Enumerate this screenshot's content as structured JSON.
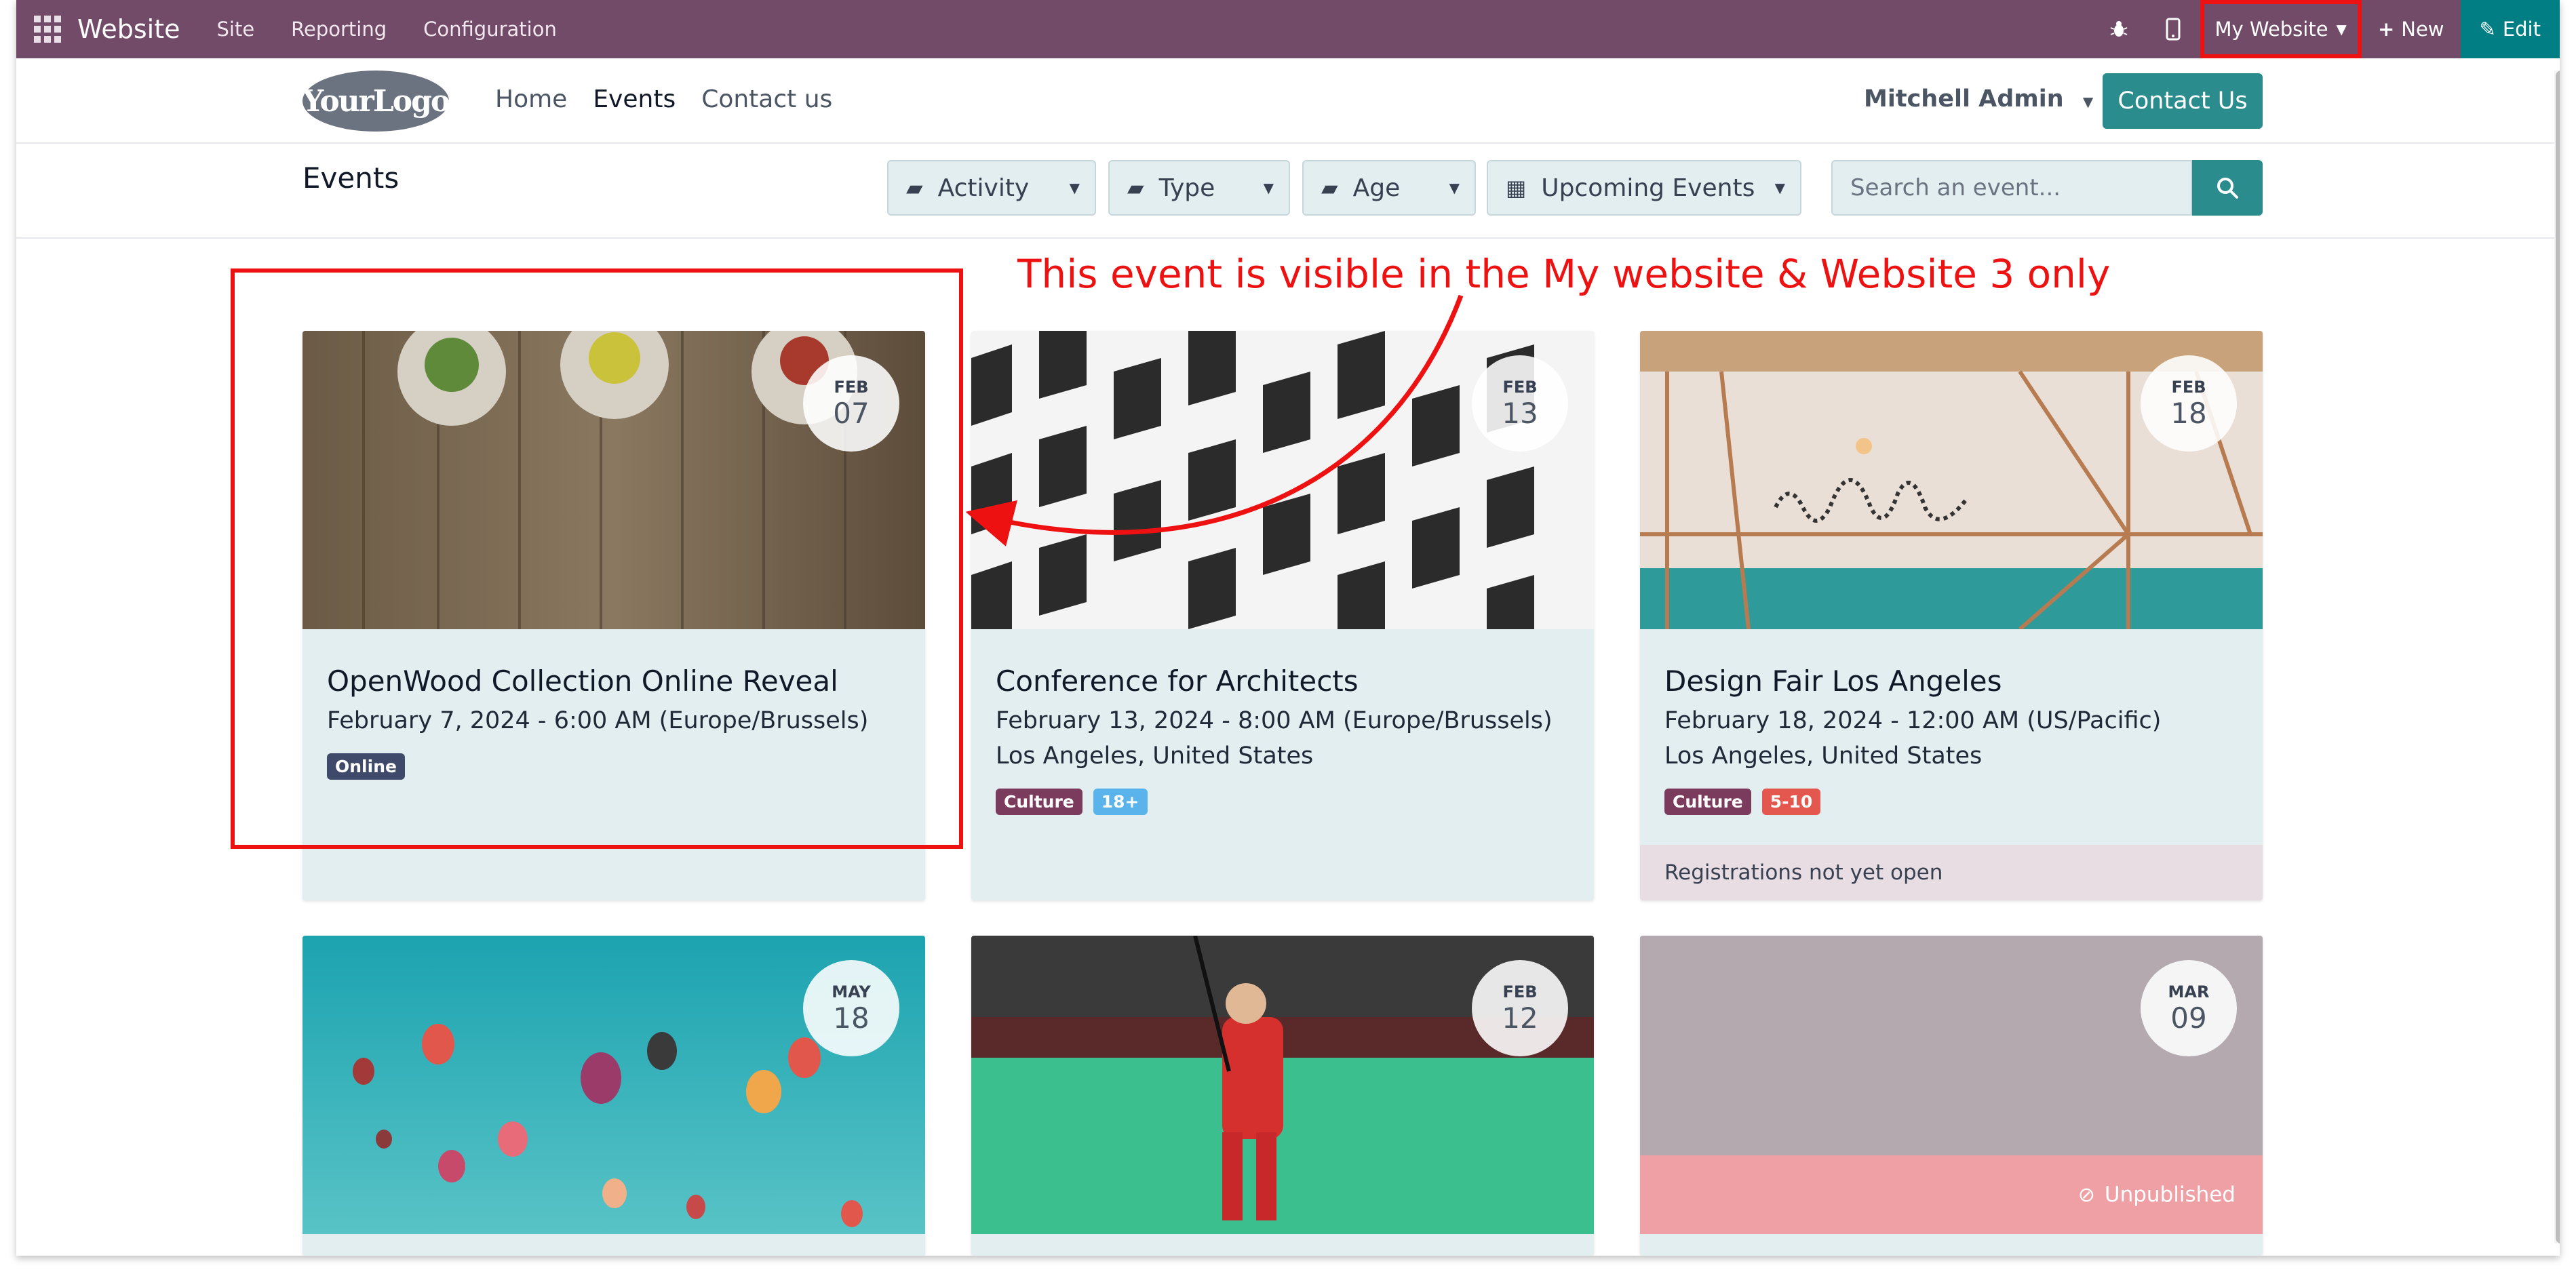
{
  "topbar": {
    "brand": "Website",
    "menu": [
      "Site",
      "Reporting",
      "Configuration"
    ],
    "website_selector": "My Website",
    "new_label": "New",
    "edit_label": "Edit"
  },
  "header": {
    "logo_text": "YourLogo",
    "nav": [
      "Home",
      "Events",
      "Contact us"
    ],
    "user": "Mitchell Admin",
    "contact_button": "Contact Us"
  },
  "events_bar": {
    "title": "Events",
    "filters": [
      "Activity",
      "Type",
      "Age",
      "Upcoming Events"
    ],
    "search_placeholder": "Search an event..."
  },
  "annotation": {
    "text": "This event is visible in the My website & Website 3 only",
    "color": "#ee1111"
  },
  "cards": [
    {
      "month": "FEB",
      "day": "07",
      "title": "OpenWood Collection Online Reveal",
      "date": "February 7, 2024 - 6:00 AM (Europe/Brussels)",
      "location": "",
      "tags": [
        {
          "label": "Online",
          "color": "#3f4a6b"
        }
      ],
      "footer": ""
    },
    {
      "month": "FEB",
      "day": "13",
      "title": "Conference for Architects",
      "date": "February 13, 2024 - 8:00 AM (Europe/Brussels)",
      "location": "Los Angeles, United States",
      "tags": [
        {
          "label": "Culture",
          "color": "#7b3b5c"
        },
        {
          "label": "18+",
          "color": "#5ab3ea"
        }
      ],
      "footer": ""
    },
    {
      "month": "FEB",
      "day": "18",
      "title": "Design Fair Los Angeles",
      "date": "February 18, 2024 - 12:00 AM (US/Pacific)",
      "location": "Los Angeles, United States",
      "tags": [
        {
          "label": "Culture",
          "color": "#7b3b5c"
        },
        {
          "label": "5-10",
          "color": "#e4574e"
        }
      ],
      "footer": "Registrations not yet open"
    },
    {
      "month": "MAY",
      "day": "18"
    },
    {
      "month": "FEB",
      "day": "12"
    },
    {
      "month": "MAR",
      "day": "09",
      "unpublished": "Unpublished"
    }
  ],
  "colors": {
    "topbar": "#714b67",
    "edit": "#017e84",
    "primary": "#2a8c8c",
    "card_bg": "#e2eef0"
  }
}
